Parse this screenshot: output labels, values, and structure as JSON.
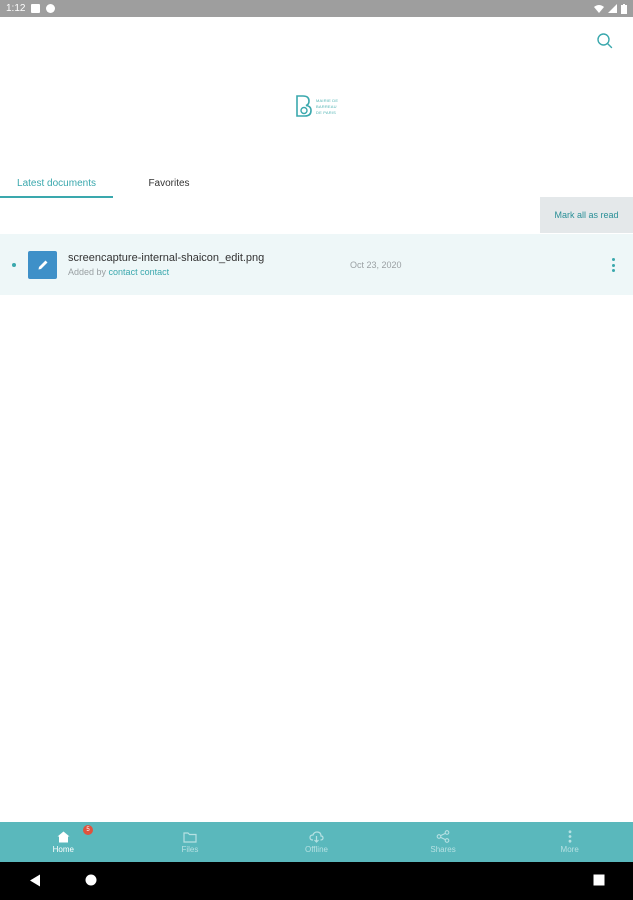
{
  "status_bar": {
    "time": "1:12"
  },
  "header": {
    "search_icon": "search-icon"
  },
  "logo": {
    "line1": "MAIRIE DE",
    "line2": "BARREAU",
    "line3": "DE PARIS"
  },
  "tabs": [
    {
      "label": "Latest documents",
      "active": true
    },
    {
      "label": "Favorites",
      "active": false
    }
  ],
  "actions": {
    "mark_all_read": "Mark all as read"
  },
  "documents": [
    {
      "name": "screencapture-internal-shaicon_edit.png",
      "added_by_prefix": "Added by",
      "added_by": "contact contact",
      "date": "Oct 23, 2020",
      "unread": true,
      "icon": "edit-icon"
    }
  ],
  "bottom_nav": {
    "items": [
      {
        "label": "Home",
        "icon": "home-icon",
        "active": true,
        "badge": "5"
      },
      {
        "label": "Files",
        "icon": "folder-icon",
        "active": false
      },
      {
        "label": "Offline",
        "icon": "cloud-download-icon",
        "active": false
      },
      {
        "label": "Shares",
        "icon": "share-icon",
        "active": false
      },
      {
        "label": "More",
        "icon": "more-vertical-icon",
        "active": false
      }
    ]
  },
  "colors": {
    "accent": "#3aa8ad",
    "nav_bar": "#5ab8bc",
    "row_highlight": "#eef7f8",
    "badge": "#e0523d",
    "doc_icon": "#3e90c8"
  }
}
